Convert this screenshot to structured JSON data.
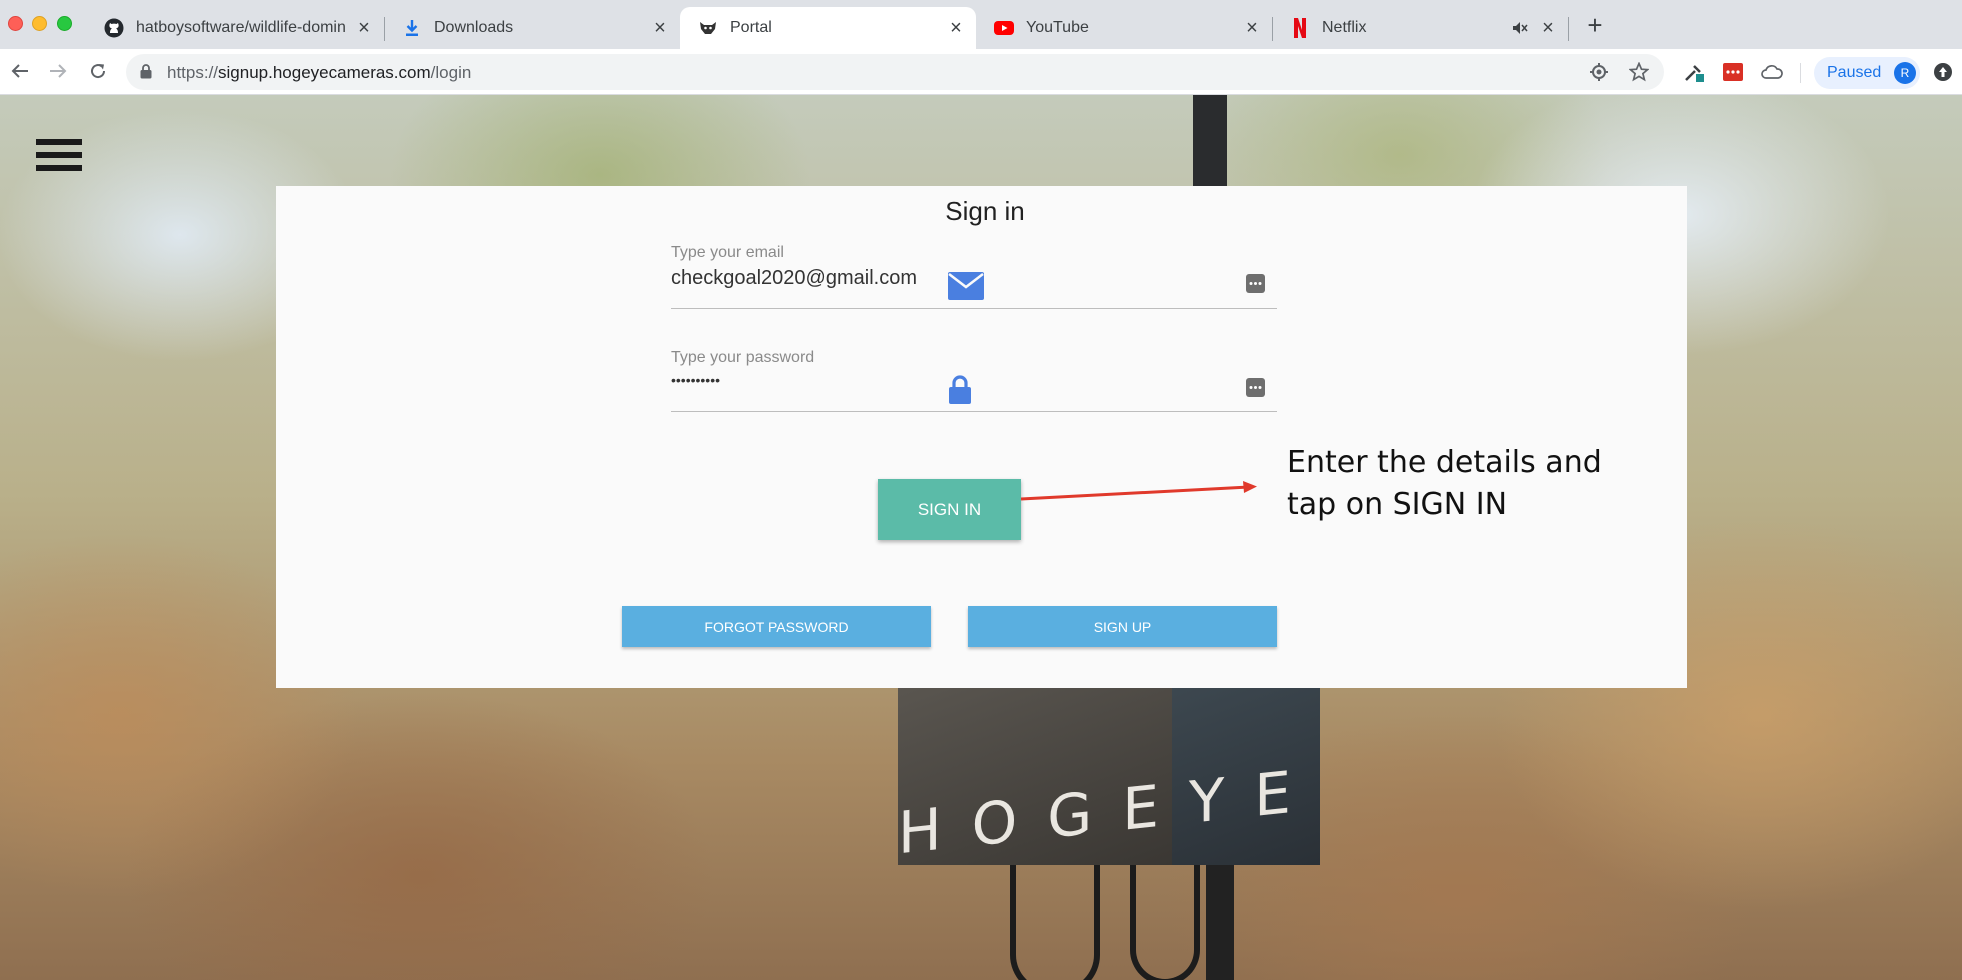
{
  "browser": {
    "tabs": [
      {
        "title": "hatboysoftware/wildlife-domin",
        "icon": "github-icon"
      },
      {
        "title": "Downloads",
        "icon": "download-icon"
      },
      {
        "title": "Portal",
        "icon": "hog-logo-icon",
        "active": true
      },
      {
        "title": "YouTube",
        "icon": "youtube-icon"
      },
      {
        "title": "Netflix",
        "icon": "netflix-icon",
        "muted": true
      }
    ],
    "url": {
      "scheme": "https://",
      "host": "signup.hogeyecameras.com",
      "path": "/login"
    },
    "profile": {
      "status": "Paused",
      "initial": "R"
    }
  },
  "page": {
    "title": "Sign in",
    "email": {
      "label": "Type your email",
      "value": "checkgoal2020@gmail.com"
    },
    "password": {
      "label": "Type your password",
      "value": "••••••••••"
    },
    "sign_in_label": "SIGN IN",
    "forgot_password_label": "FORGOT PASSWORD",
    "sign_up_label": "SIGN UP",
    "annotation_line1": "Enter the details and",
    "annotation_line2": "tap on SIGN IN",
    "camera_brand": "HOGEYE"
  },
  "colors": {
    "sign_in_button": "#5bbba8",
    "secondary_buttons": "#5aafe0",
    "field_icons": "#4a7fe0",
    "arrow": "#e0392b"
  }
}
